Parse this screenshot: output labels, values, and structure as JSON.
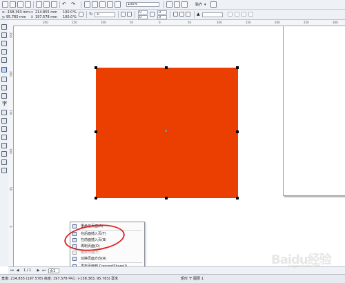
{
  "toolbar": {
    "zoom": "100%",
    "snap_label": "贴齐",
    "nudge": "1",
    "offset": ".0",
    "outline_width": ".2 mm"
  },
  "property_bar": {
    "x": "x: -158.363 mm",
    "y": "y: 95.783 mm",
    "width": "214.855 mm",
    "height": "197.578 mm",
    "scale_x": "100.0",
    "scale_y": "100.0",
    "percent": "%",
    "angle": ".0",
    "corner1": "0",
    "corner2": "0",
    "corner3": "0",
    "corner4": "0"
  },
  "rulers": {
    "h_ticks": [
      "200",
      "150",
      "100",
      "50",
      "0",
      "50",
      "100",
      "150",
      "200",
      "250",
      "300"
    ],
    "v_ticks": [
      "250",
      "200",
      "150",
      "100",
      "50",
      "0"
    ],
    "unit": "毫米"
  },
  "object": {
    "fill_color": "#ea3f00"
  },
  "context_menu": {
    "items": [
      {
        "label": "重命名页面(A)",
        "enabled": true
      },
      {
        "label": "在后面插入页(F)",
        "enabled": true
      },
      {
        "label": "在前面插入页(B)",
        "enabled": true
      },
      {
        "label": "再制页面(D)",
        "enabled": true
      },
      {
        "label": "删除页面(E)",
        "enabled": false
      },
      {
        "label": "切换页面方向(R)",
        "enabled": true
      },
      {
        "label": "发布页面到 ConceptShare(I)...",
        "enabled": true
      }
    ]
  },
  "page_bar": {
    "count": "1 / 1",
    "tab": "页1"
  },
  "status_bar": {
    "text": "宽度: 214.855 (197.578) 高度: 197.578 中心: (-158.363, 95.783) 毫米",
    "layer": "矩形 于 图层 1"
  },
  "watermark": {
    "main": "Baidu经验",
    "sub": "jingyan.baidu.com"
  }
}
